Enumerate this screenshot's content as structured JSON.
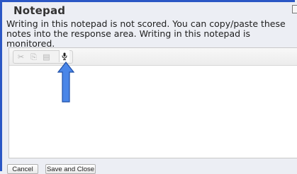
{
  "window": {
    "title": "Notepad"
  },
  "notice": "Writing in this notepad is not scored. You can copy/paste these notes into the response area. Writing in this notepad is monitored.",
  "toolbar": {
    "cut_icon": "cut-icon",
    "copy_icon": "copy-icon",
    "paste_icon": "paste-icon",
    "mic_icon": "microphone-icon"
  },
  "editor": {
    "value": ""
  },
  "colors": {
    "frame_border": "#2b57c5",
    "arrow_fill": "#4a86e8",
    "arrow_stroke": "#1f4fa8",
    "background": "#eceef4"
  },
  "footer": {
    "cancel_label": "Cancel",
    "save_close_label": "Save and Close"
  }
}
